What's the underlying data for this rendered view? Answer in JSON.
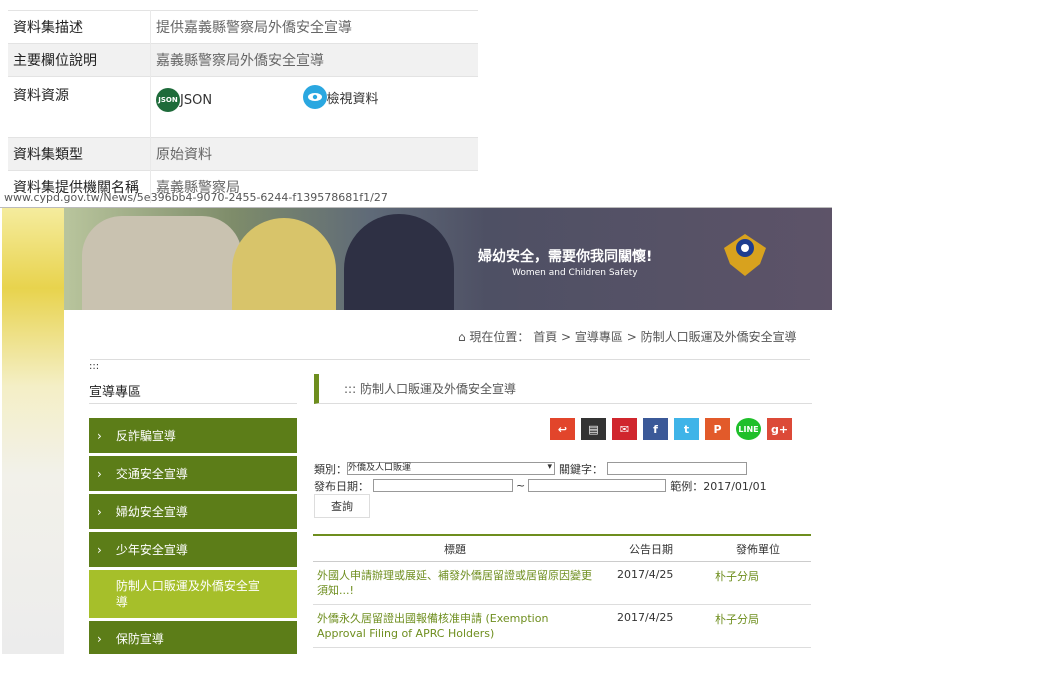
{
  "meta_table": {
    "rows": [
      {
        "key": "資料集描述",
        "value": "提供嘉義縣警察局外僑安全宣導"
      },
      {
        "key": "主要欄位說明",
        "value": "嘉義縣警察局外僑安全宣導"
      },
      {
        "key": "資料資源"
      },
      {
        "key": "資料集類型",
        "value": "原始資料"
      },
      {
        "key": "資料集提供機關名稱",
        "value": "嘉義縣警察局"
      }
    ],
    "resources": {
      "json_icon_text": "JSON",
      "json_label": "JSON",
      "view_label": "檢視資料"
    }
  },
  "url": "www.cypd.gov.tw/News/5e396bb4-9070-2455-6244-f139578681f1/27",
  "site": {
    "banner_title": "婦幼安全，需要你我同關懷!",
    "banner_subtitle": "Women and Children Safety",
    "breadcrumb": "⌂ 現在位置： 首頁 > 宣導專區 > 防制人口販運及外僑安全宣導",
    "dots": ":::",
    "sidebar_title": "宣導專區",
    "nav": [
      "反詐騙宣導",
      "交通安全宣導",
      "婦幼安全宣導",
      "少年安全宣導",
      "防制人口販運及外僑安全宣導",
      "保防宣導"
    ],
    "main_title": "::: 防制人口販運及外僑安全宣導",
    "share_icons": [
      "back-icon",
      "print-icon",
      "mail-icon",
      "facebook-icon",
      "twitter-icon",
      "plurk-icon",
      "line-icon",
      "googleplus-icon"
    ],
    "share_glyphs": [
      "↩",
      "▤",
      "✉",
      "f",
      "t",
      "P",
      "LINE",
      "g+"
    ],
    "form": {
      "category_label": "類別：",
      "category_value": "外僑及人口販運",
      "keyword_label": "關鍵字：",
      "date_label": "發布日期：",
      "tilde": "~",
      "example": "範例：2017/01/01",
      "search_button": "查詢"
    },
    "table": {
      "headers": [
        "標題",
        "公告日期",
        "發佈單位"
      ],
      "rows": [
        {
          "title": "外國人申請辦理或展延、補發外僑居留證或居留原因變更須知...!",
          "date": "2017/4/25",
          "unit": "朴子分局"
        },
        {
          "title": "外僑永久居留證出國報備核准申請 (Exemption Approval Filing of APRC Holders)",
          "date": "2017/4/25",
          "unit": "朴子分局"
        }
      ]
    }
  },
  "colors": {
    "green": "#5c7d18",
    "active": "#a6bf2a",
    "link": "#1c6ea4"
  }
}
